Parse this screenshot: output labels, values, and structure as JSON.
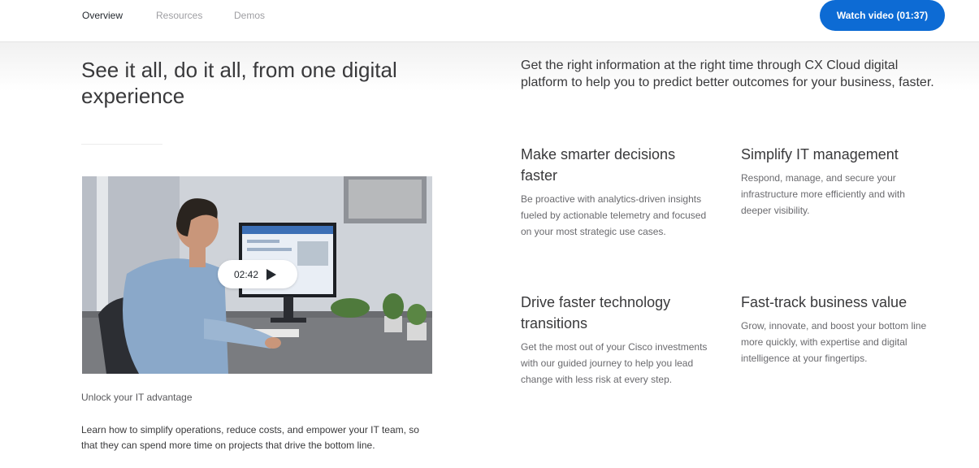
{
  "nav": {
    "tabs": [
      {
        "label": "Overview",
        "active": true
      },
      {
        "label": "Resources",
        "active": false
      },
      {
        "label": "Demos",
        "active": false
      }
    ],
    "watch_video_label": "Watch video (01:37)"
  },
  "hero": {
    "title": "See it all, do it all, from one digital experience",
    "intro": "Get the right information at the right time through CX Cloud digital platform to help you to predict better outcomes for your business, faster."
  },
  "video": {
    "duration": "02:42",
    "icon": "play-icon"
  },
  "promo": {
    "heading": "Unlock your IT advantage",
    "body": "Learn how to simplify operations, reduce costs, and empower your IT team, so that they can spend more time on projects that drive the bottom line."
  },
  "features": [
    {
      "title": "Make smarter decisions faster",
      "body": "Be proactive with analytics-driven insights fueled by actionable telemetry and focused on your most strategic use cases."
    },
    {
      "title": "Simplify IT management",
      "body": "Respond, manage, and secure your infrastructure more efficiently and with deeper visibility."
    },
    {
      "title": "Drive faster technology transitions",
      "body": "Get the most out of your Cisco investments with our guided journey to help you lead change with less risk at every step."
    },
    {
      "title": "Fast-track business value",
      "body": "Grow, innovate, and boost your bottom line more quickly, with expertise and digital intelligence at your fingertips."
    }
  ],
  "colors": {
    "accent": "#0d6bd4",
    "text": "#39393b",
    "muted": "#6a6a6e"
  }
}
